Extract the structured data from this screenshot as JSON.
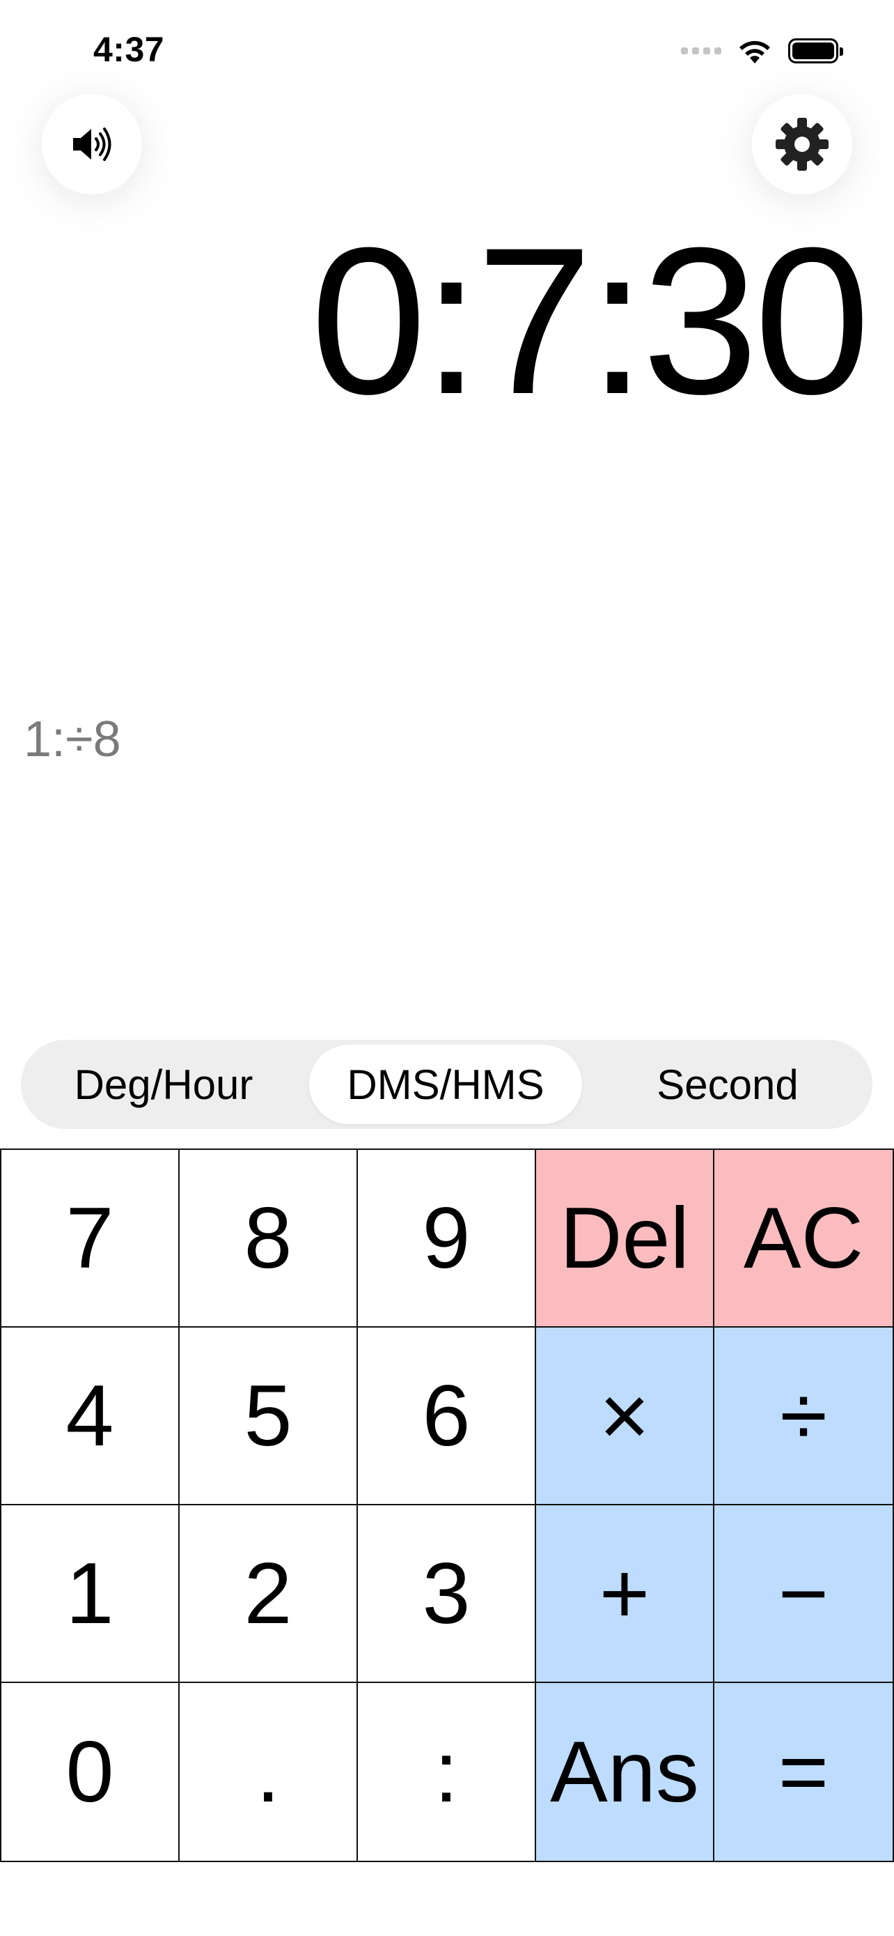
{
  "status_bar": {
    "time": "4:37"
  },
  "icons": {
    "sound": "speaker-volume-icon",
    "settings": "gear-icon",
    "wifi": "wifi-icon",
    "battery": "battery-icon",
    "signal": "cellular-signal-icon"
  },
  "display": {
    "result": "0:7:30",
    "expression": "1:÷8"
  },
  "segmented": {
    "options": [
      "Deg/Hour",
      "DMS/HMS",
      "Second"
    ],
    "selected": "DMS/HMS"
  },
  "keypad": {
    "keys": [
      {
        "label": "7"
      },
      {
        "label": "8"
      },
      {
        "label": "9"
      },
      {
        "label": "Del"
      },
      {
        "label": "AC"
      },
      {
        "label": "4"
      },
      {
        "label": "5"
      },
      {
        "label": "6"
      },
      {
        "label": "×"
      },
      {
        "label": "÷"
      },
      {
        "label": "1"
      },
      {
        "label": "2"
      },
      {
        "label": "3"
      },
      {
        "label": "+"
      },
      {
        "label": "−"
      },
      {
        "label": "0"
      },
      {
        "label": "."
      },
      {
        "label": ":"
      },
      {
        "label": "Ans"
      },
      {
        "label": "="
      }
    ]
  },
  "colors": {
    "clear_keys": "#fbbcc0",
    "operator_keys": "#bedcfd",
    "segment_bg": "#eeeeee",
    "expression_text": "#7a7a7a"
  }
}
